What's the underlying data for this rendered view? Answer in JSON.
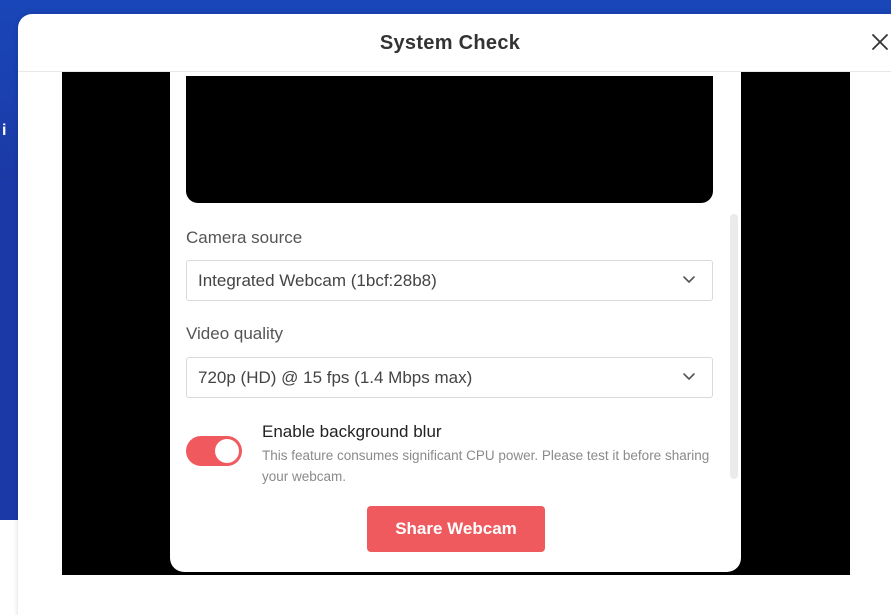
{
  "background": {
    "peek_text": "i"
  },
  "modal": {
    "title": "System Check",
    "close_icon": "close-icon"
  },
  "camera": {
    "label": "Camera source",
    "selected": "Integrated Webcam (1bcf:28b8)"
  },
  "quality": {
    "label": "Video quality",
    "selected": "720p (HD) @ 15 fps (1.4 Mbps max)"
  },
  "blur": {
    "title": "Enable background blur",
    "description": "This feature consumes significant CPU power. Please test it before sharing your webcam.",
    "enabled": true
  },
  "actions": {
    "share_label": "Share Webcam"
  },
  "colors": {
    "accent": "#ee5a5e",
    "background_brand": "#1b3fae"
  }
}
